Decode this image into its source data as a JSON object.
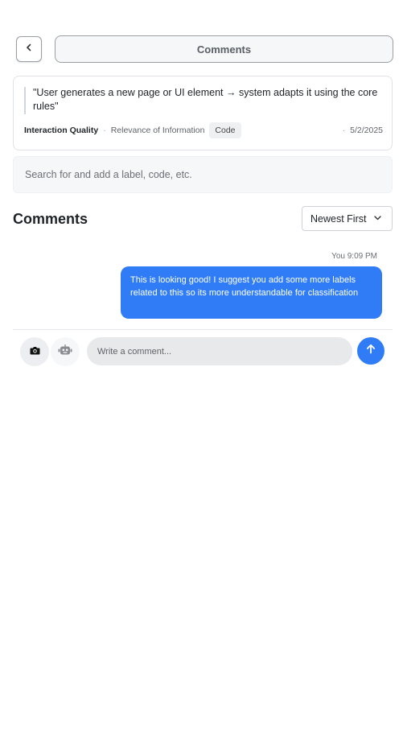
{
  "header": {
    "back_icon": "chevron-left-icon",
    "title": "Comments"
  },
  "card": {
    "quote": "\"User generates a new page or UI element → system adapts it using the core rules\"",
    "category": "Interaction Quality",
    "separator": "·",
    "subcategory": "Relevance of Information",
    "badge": "Code",
    "date": "5/2/2025"
  },
  "search": {
    "placeholder": "Search for and add a label, code, etc.",
    "value": ""
  },
  "comments_section": {
    "title": "Comments",
    "sort": {
      "selected": "Newest First",
      "icon": "chevron-down-icon"
    }
  },
  "messages": [
    {
      "author": "You",
      "time": "9:09 PM",
      "text": "This is looking good! I suggest you add some more labels related to this so its more understandable for classification"
    }
  ],
  "composer": {
    "camera_icon": "camera-icon",
    "bot_icon": "robot-icon",
    "placeholder": "Write a comment...",
    "value": "",
    "send_icon": "arrow-up-icon"
  },
  "colors": {
    "accent": "#2f7cf6",
    "bubble_text": "#ffffff",
    "surface": "#f6f7f9",
    "border": "#dfe2e6"
  }
}
